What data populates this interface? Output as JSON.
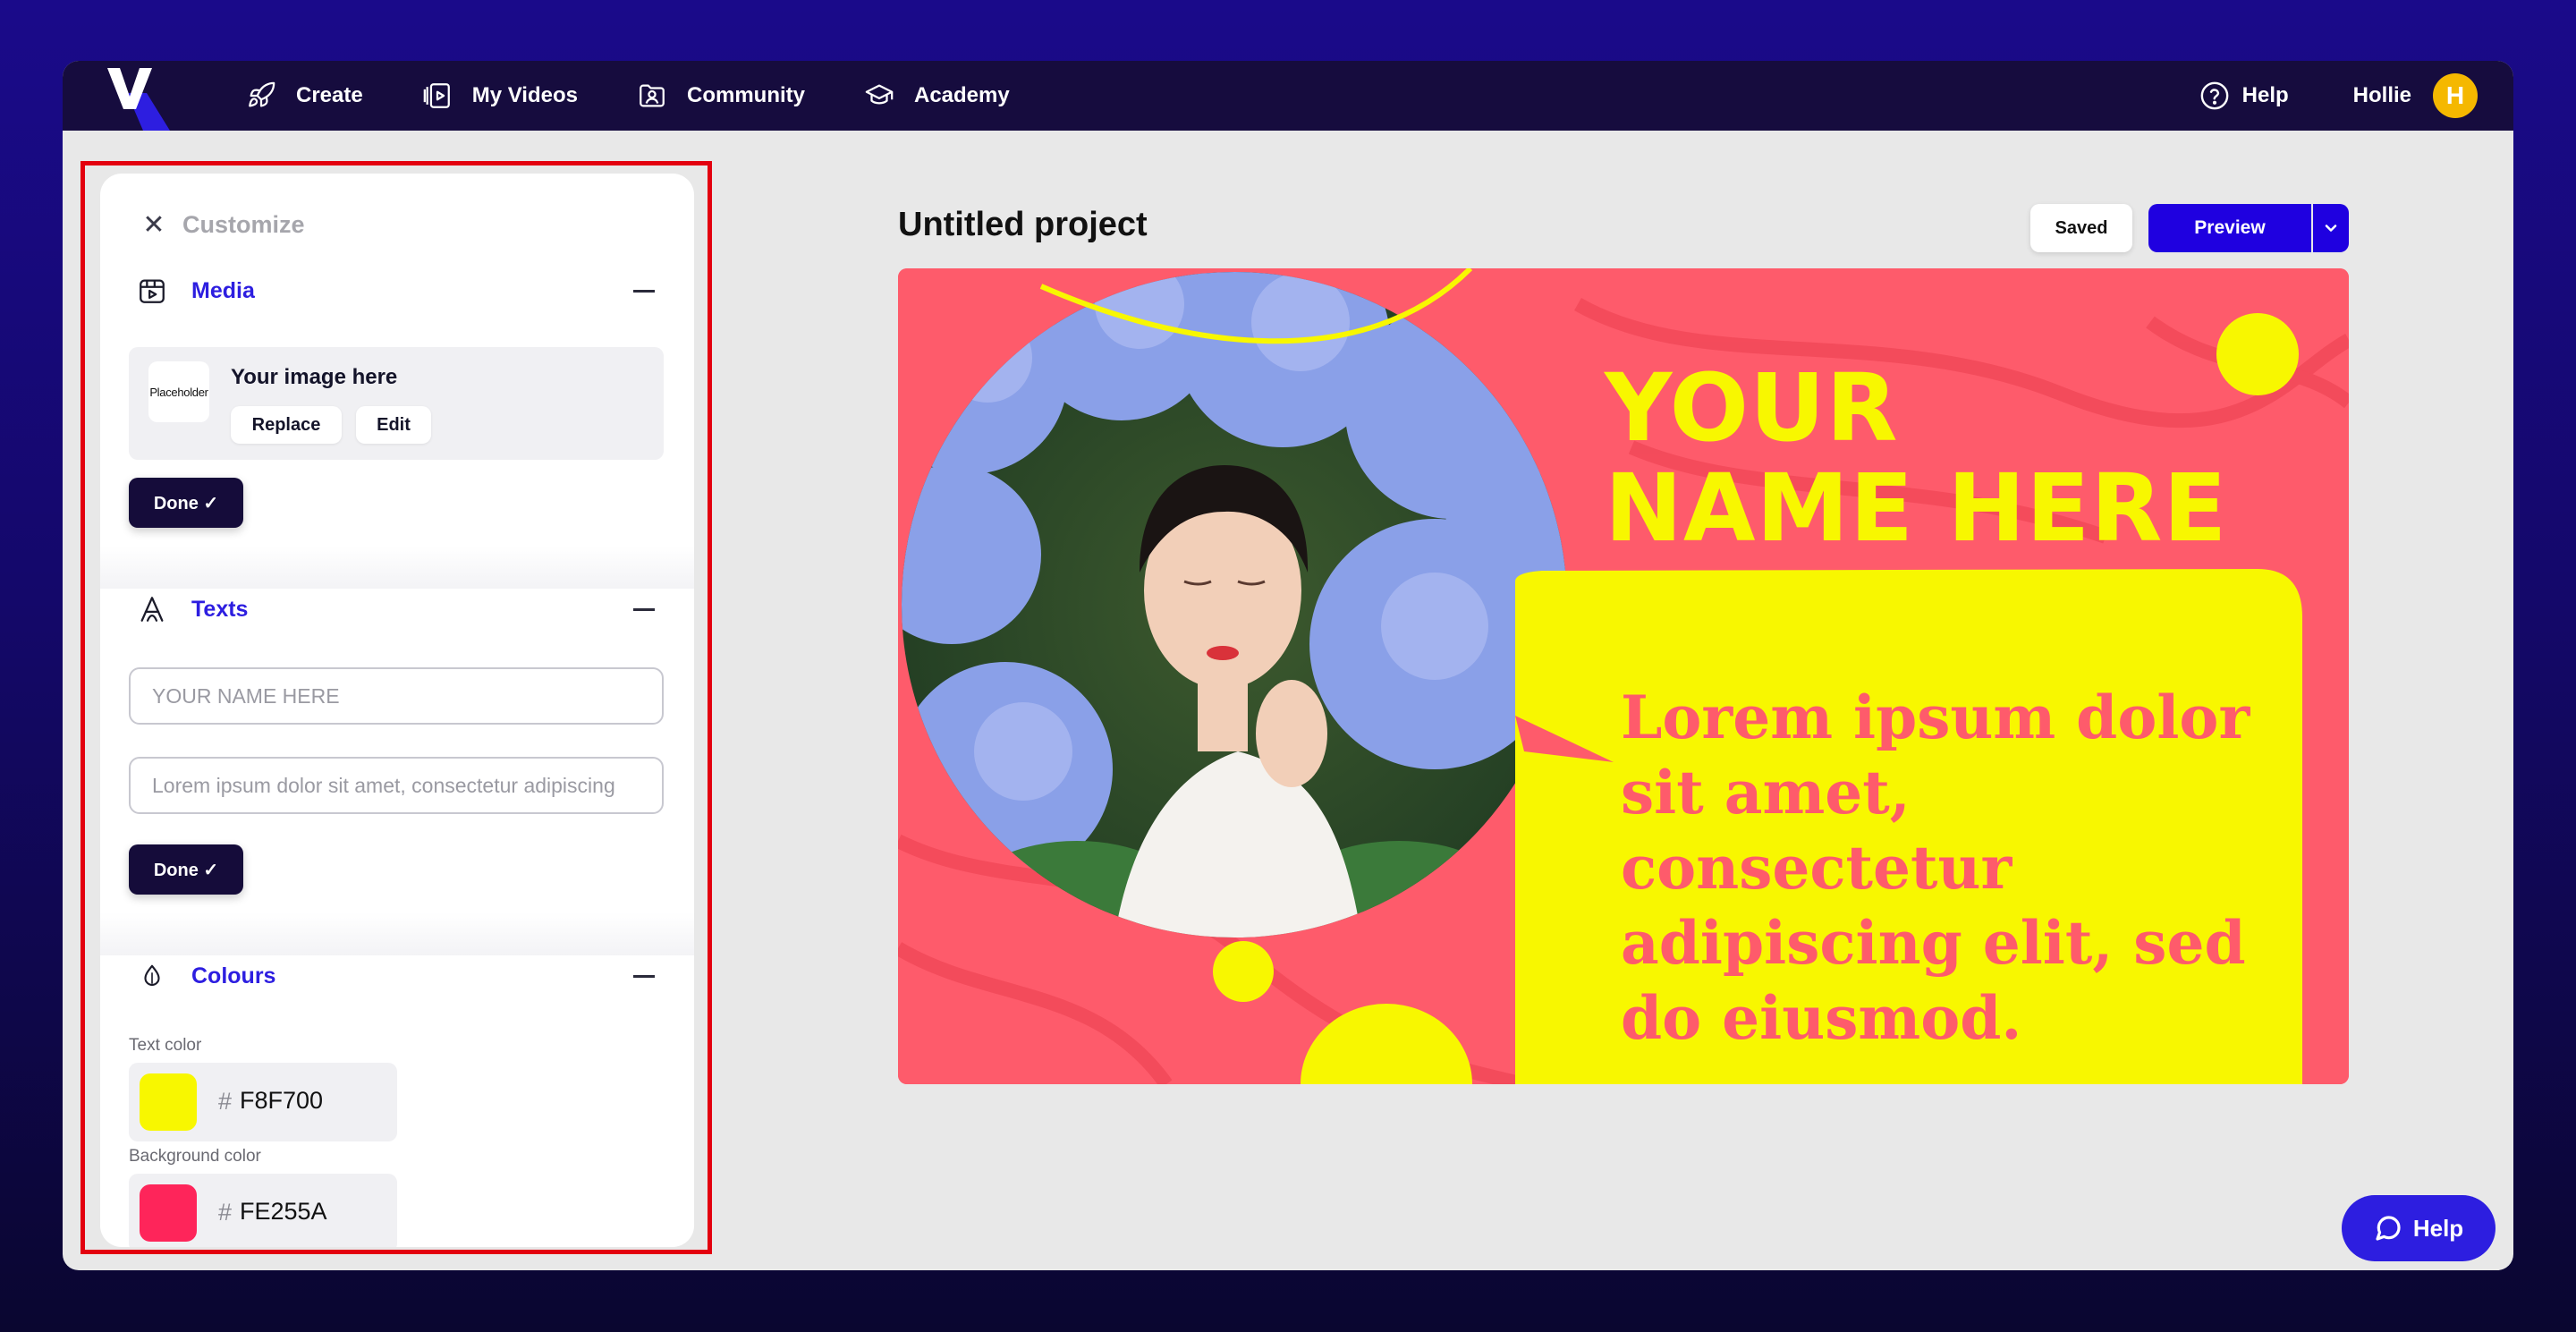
{
  "nav": {
    "items": [
      {
        "label": "Create",
        "icon": "rocket-icon"
      },
      {
        "label": "My Videos",
        "icon": "video-library-icon"
      },
      {
        "label": "Community",
        "icon": "community-icon"
      },
      {
        "label": "Academy",
        "icon": "graduation-cap-icon"
      }
    ],
    "help_label": "Help",
    "username": "Hollie",
    "avatar_initial": "H"
  },
  "panel": {
    "title": "Customize",
    "media": {
      "title": "Media",
      "thumb_text": "Placeholder",
      "image_title": "Your image here",
      "replace_label": "Replace",
      "edit_label": "Edit",
      "done_label": "Done ✓"
    },
    "texts": {
      "title": "Texts",
      "name_placeholder": "YOUR NAME HERE",
      "body_placeholder": "Lorem ipsum dolor sit amet, consectetur adipiscing",
      "done_label": "Done ✓"
    },
    "colours": {
      "title": "Colours",
      "text_color_label": "Text color",
      "text_color_hex": "F8F700",
      "text_color_value": "#F8F700",
      "bg_color_label": "Background color",
      "bg_color_hex": "FE255A",
      "bg_color_value": "#FE255A",
      "hash": "#"
    }
  },
  "project": {
    "title": "Untitled project",
    "saved_label": "Saved",
    "preview_label": "Preview"
  },
  "canvas": {
    "title_line1": "YOUR",
    "title_line2": "NAME HERE",
    "body": "Lorem ipsum dolor sit amet, consectetur adipiscing elit, sed do eiusmod."
  },
  "help_fab": {
    "label": "Help"
  }
}
